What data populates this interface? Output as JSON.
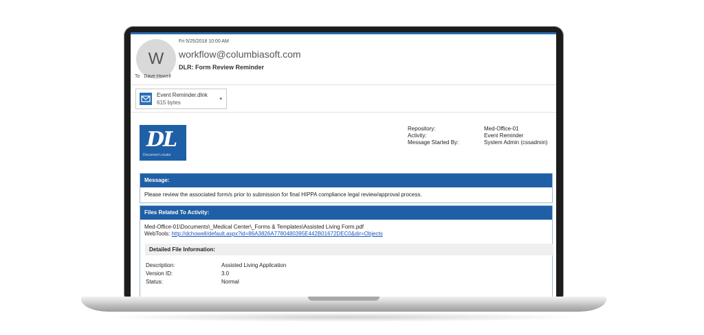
{
  "email": {
    "date": "Fri 5/25/2018 10:00 AM",
    "avatar_letter": "W",
    "sender": "workflow@columbiasoft.com",
    "subject": "DLR: Form Review Reminder",
    "to_label": "To",
    "to_name": "Dave Howell"
  },
  "attachment": {
    "filename": "Event Reminder.dlnk",
    "size": "615 bytes",
    "icon": "mail-icon"
  },
  "logo": {
    "text": "DL",
    "caption": "Document Locator",
    "color": "#1f5fa6"
  },
  "meta": {
    "repository_label": "Repository:",
    "repository_value": "Med-Office-01",
    "activity_label": "Activity:",
    "activity_value": "Event Reminder",
    "started_label": "Message Started By:",
    "started_value": "System Admin (cssadmin)"
  },
  "message": {
    "header": "Message:",
    "body": "Please review the associated form/s prior to submission for final HIPPA compliance legal review/approval process."
  },
  "files": {
    "header": "Files Related To Activity:",
    "path": "Med-Office-01\\Documents\\_Medical Center\\_Forms & Templates\\Assisted Living Form.pdf",
    "webtools_label": "WebTools:",
    "webtools_link": "http://dchowell/default.aspx?id=86A3826A7780480395E442B01672DEC0&dir=Objects",
    "detail_header": "Detailed File Information:",
    "details": [
      {
        "label": "Description:",
        "value": "Assisted Living Application"
      },
      {
        "label": "Version ID:",
        "value": "3.0"
      },
      {
        "label": "Status:",
        "value": "Normal"
      }
    ]
  }
}
